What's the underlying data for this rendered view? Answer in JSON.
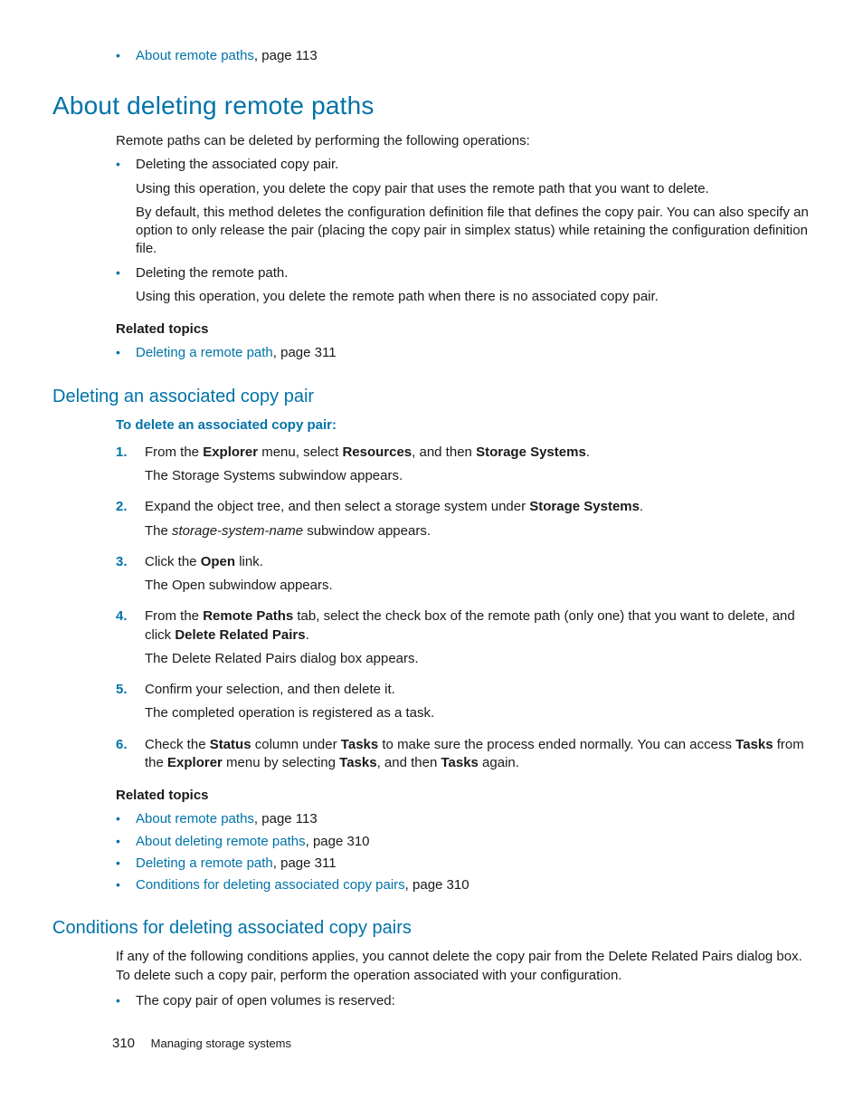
{
  "topref": {
    "link": "About remote paths",
    "tail": ", page 113"
  },
  "h1": "About deleting remote paths",
  "intro": "Remote paths can be deleted by performing the following operations:",
  "ops": [
    {
      "lead": "Deleting the associated copy pair.",
      "p1": "Using this operation, you delete the copy pair that uses the remote path that you want to delete.",
      "p2": "By default, this method deletes the configuration definition file that defines the copy pair. You can also specify an option to only release the pair (placing the copy pair in simplex status) while retaining the configuration definition file."
    },
    {
      "lead": "Deleting the remote path.",
      "p1": "Using this operation, you delete the remote path when there is no associated copy pair."
    }
  ],
  "rel1_label": "Related topics",
  "rel1": {
    "link": "Deleting a remote path",
    "tail": ", page 311"
  },
  "h2a": "Deleting an associated copy pair",
  "proc_label": "To delete an associated copy pair:",
  "steps": {
    "s1": {
      "t0": "From the ",
      "b1": "Explorer",
      "t1": " menu, select ",
      "b2": "Resources",
      "t2": ", and then ",
      "b3": "Storage Systems",
      "t3": ".",
      "after": "The Storage Systems subwindow appears."
    },
    "s2": {
      "t0": "Expand the object tree, and then select a storage system under ",
      "b1": "Storage Systems",
      "t1": ".",
      "after_pre": "The ",
      "after_i": "storage-system-name",
      "after_post": " subwindow appears."
    },
    "s3": {
      "t0": "Click the ",
      "b1": "Open",
      "t1": " link.",
      "after": "The Open subwindow appears."
    },
    "s4": {
      "t0": "From the ",
      "b1": "Remote Paths",
      "t1": " tab, select the check box of the remote path (only one) that you want to delete, and click ",
      "b2": "Delete Related Pairs",
      "t2": ".",
      "after": "The Delete Related Pairs dialog box appears."
    },
    "s5": {
      "t0": "Confirm your selection, and then delete it.",
      "after": "The completed operation is registered as a task."
    },
    "s6": {
      "t0": "Check the ",
      "b1": "Status",
      "t1": " column under ",
      "b2": "Tasks",
      "t2": " to make sure the process ended normally. You can access ",
      "b3": "Tasks",
      "t3": " from the ",
      "b4": "Explorer",
      "t4": " menu by selecting ",
      "b5": "Tasks",
      "t5": ", and then ",
      "b6": "Tasks",
      "t6": " again."
    }
  },
  "rel2_label": "Related topics",
  "rel2": [
    {
      "link": "About remote paths",
      "tail": ", page 113"
    },
    {
      "link": "About deleting remote paths",
      "tail": ", page 310"
    },
    {
      "link": "Deleting a remote path",
      "tail": ", page 311"
    },
    {
      "link": "Conditions for deleting associated copy pairs",
      "tail": ", page 310"
    }
  ],
  "h2b": "Conditions for deleting associated copy pairs",
  "cond_p": "If any of the following conditions applies, you cannot delete the copy pair from the Delete Related Pairs dialog box. To delete such a copy pair, perform the operation associated with your configuration.",
  "cond_b1": "The copy pair of open volumes is reserved:",
  "footer": {
    "page": "310",
    "title": "Managing storage systems"
  }
}
